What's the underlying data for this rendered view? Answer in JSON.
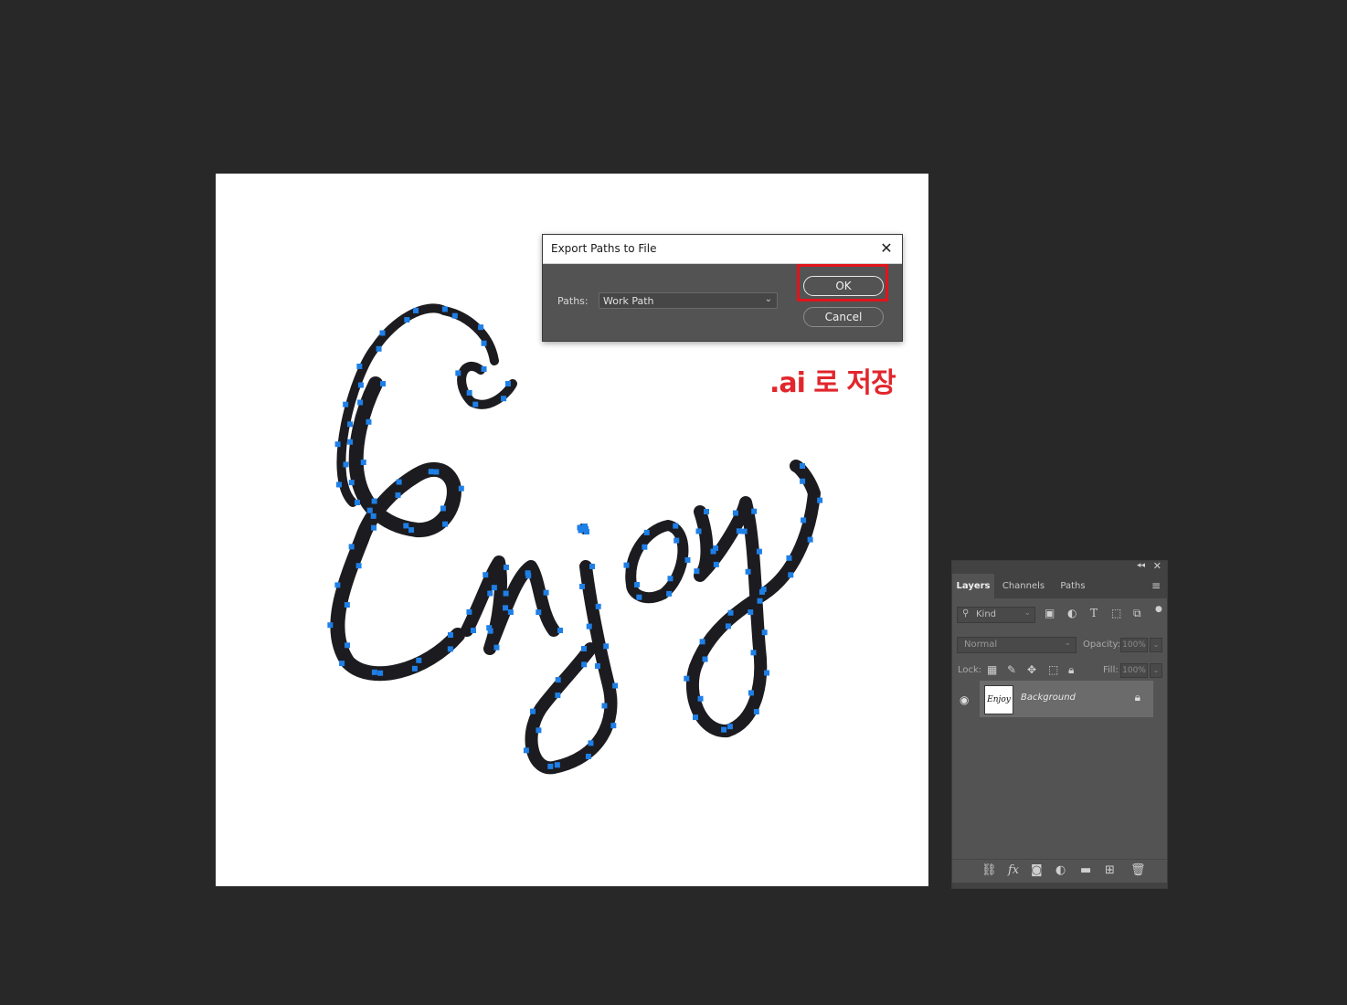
{
  "canvas": {
    "lettering": "Enjoy",
    "anchor_color": "#1e7fe6",
    "ink_color": "#1c1b1f"
  },
  "dialog": {
    "title": "Export Paths to File",
    "close_icon": "close-icon",
    "paths_label": "Paths:",
    "paths_value": "Work Path",
    "ok_label": "OK",
    "cancel_label": "Cancel"
  },
  "annotation": {
    "text": ".ai 로 저장",
    "color": "#e1262c"
  },
  "layers_panel": {
    "tabs": [
      "Layers",
      "Channels",
      "Paths"
    ],
    "active_tab": "Layers",
    "filter_placeholder": "Kind",
    "blend_mode": "Normal",
    "opacity_label": "Opacity:",
    "opacity_value": "100%",
    "lock_label": "Lock:",
    "fill_label": "Fill:",
    "fill_value": "100%",
    "layer": {
      "name": "Background",
      "thumbnail_text": "Enjoy"
    }
  }
}
